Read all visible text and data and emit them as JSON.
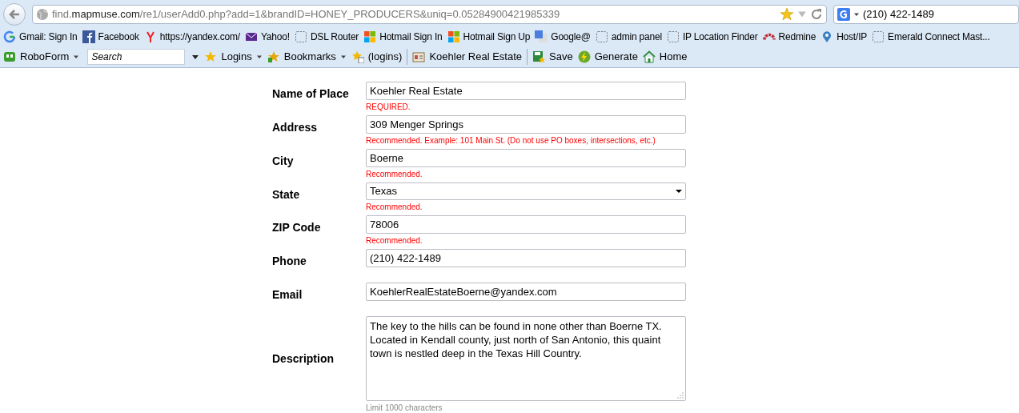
{
  "address_bar": {
    "url": "find.**mapmuse.com**/re1/userAdd0.php?add=1&brandID=HONEY_PRODUCERS&uniq=0.05284900421985339"
  },
  "search_box": {
    "value": "(210) 422-1489"
  },
  "bookmarks": [
    {
      "label": "Gmail: Sign In",
      "kind": "google"
    },
    {
      "label": "Facebook",
      "kind": "facebook"
    },
    {
      "label": "https://yandex.com/",
      "kind": "yandex"
    },
    {
      "label": "Yahoo!",
      "kind": "mail"
    },
    {
      "label": "DSL Router",
      "kind": "blank"
    },
    {
      "label": "Hotmail Sign In",
      "kind": "windows"
    },
    {
      "label": "Hotmail Sign Up",
      "kind": "windows"
    },
    {
      "label": "Google@",
      "kind": "translate"
    },
    {
      "label": "admin panel",
      "kind": "blank"
    },
    {
      "label": "IP Location Finder",
      "kind": "blank"
    },
    {
      "label": "Redmine",
      "kind": "redmine"
    },
    {
      "label": "Host/IP",
      "kind": "pin"
    },
    {
      "label": "Emerald Connect Mast...",
      "kind": "blank"
    }
  ],
  "roboform_toolbar": {
    "search_placeholder": "Search",
    "items": [
      {
        "label": "RoboForm",
        "kind": "roboform",
        "caret": true
      },
      {
        "kind": "search"
      },
      {
        "label": "Logins",
        "kind": "star",
        "caret": true
      },
      {
        "label": "Bookmarks",
        "kind": "bookmark",
        "caret": true
      },
      {
        "label": "(logins)",
        "kind": "list",
        "caret": false
      },
      {
        "kind": "separator"
      },
      {
        "label": "Koehler Real Estate",
        "kind": "card",
        "caret": false
      },
      {
        "kind": "separator"
      },
      {
        "label": "Save",
        "kind": "save",
        "caret": false
      },
      {
        "label": "Generate",
        "kind": "bolt",
        "caret": false
      },
      {
        "label": "Home",
        "kind": "home",
        "caret": false
      }
    ]
  },
  "form": [
    {
      "label": "Name of Place",
      "kind": "input",
      "value": "Koehler Real Estate",
      "note": "REQUIRED.",
      "color": "#ff0000"
    },
    {
      "label": "Address",
      "kind": "input",
      "value": "309 Menger Springs",
      "note": "Recommended.  Example: 101 Main St. (Do not use PO boxes, intersections, etc.)",
      "color": "#ff0000"
    },
    {
      "label": "City",
      "kind": "input",
      "value": "Boerne",
      "note": "Recommended.",
      "color": "#ff0000"
    },
    {
      "label": "State",
      "kind": "select",
      "value": "Texas",
      "note": "Recommended.",
      "color": "#ff0000"
    },
    {
      "label": "ZIP Code",
      "kind": "input",
      "value": "78006",
      "note": "Recommended.",
      "color": "#ff0000"
    },
    {
      "label": "Phone",
      "kind": "input",
      "value": "(210) 422-1489"
    },
    {
      "label": "Email",
      "kind": "input",
      "value": "KoehlerRealEstateBoerne@yandex.com"
    },
    {
      "label": "Description",
      "kind": "textarea",
      "value": "The key to the hills can be found in none other than Boerne TX. Located in Kendall county, just north of San Antonio, this quaint town is nestled deep in the Texas Hill Country.",
      "note": "Limit 1000 characters",
      "color": "#888888"
    }
  ]
}
